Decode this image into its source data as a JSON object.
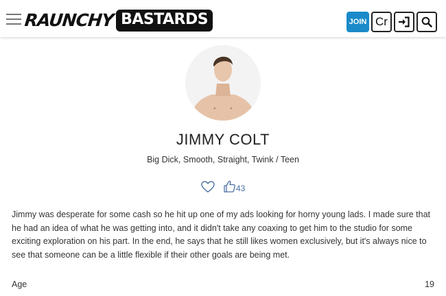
{
  "header": {
    "logo_part1": "RAUNCHY",
    "logo_part2": "BASTARDS",
    "join_label": "JOIN",
    "cr_label": "Cr",
    "login_icon": "sign-in-icon",
    "search_icon": "search-icon",
    "menu_icon": "hamburger-menu-icon",
    "join_color": "#1a8ac9"
  },
  "model": {
    "name": "JIMMY COLT",
    "tags": "Big Dick, Smooth, Straight, Twink / Teen",
    "likes": "43",
    "bio": "Jimmy was desperate for some cash so he hit up one of my ads looking for horny young lads. I made sure that he had an idea of what he was getting into, and it didn't take any coaxing to get him to the studio for some exciting exploration on his part. In the end, he says that he still likes women exclusively, but it's always nice to see that someone can be a little flexible if their other goals are being met."
  },
  "stats": [
    {
      "label": "Age",
      "value": "19"
    }
  ]
}
